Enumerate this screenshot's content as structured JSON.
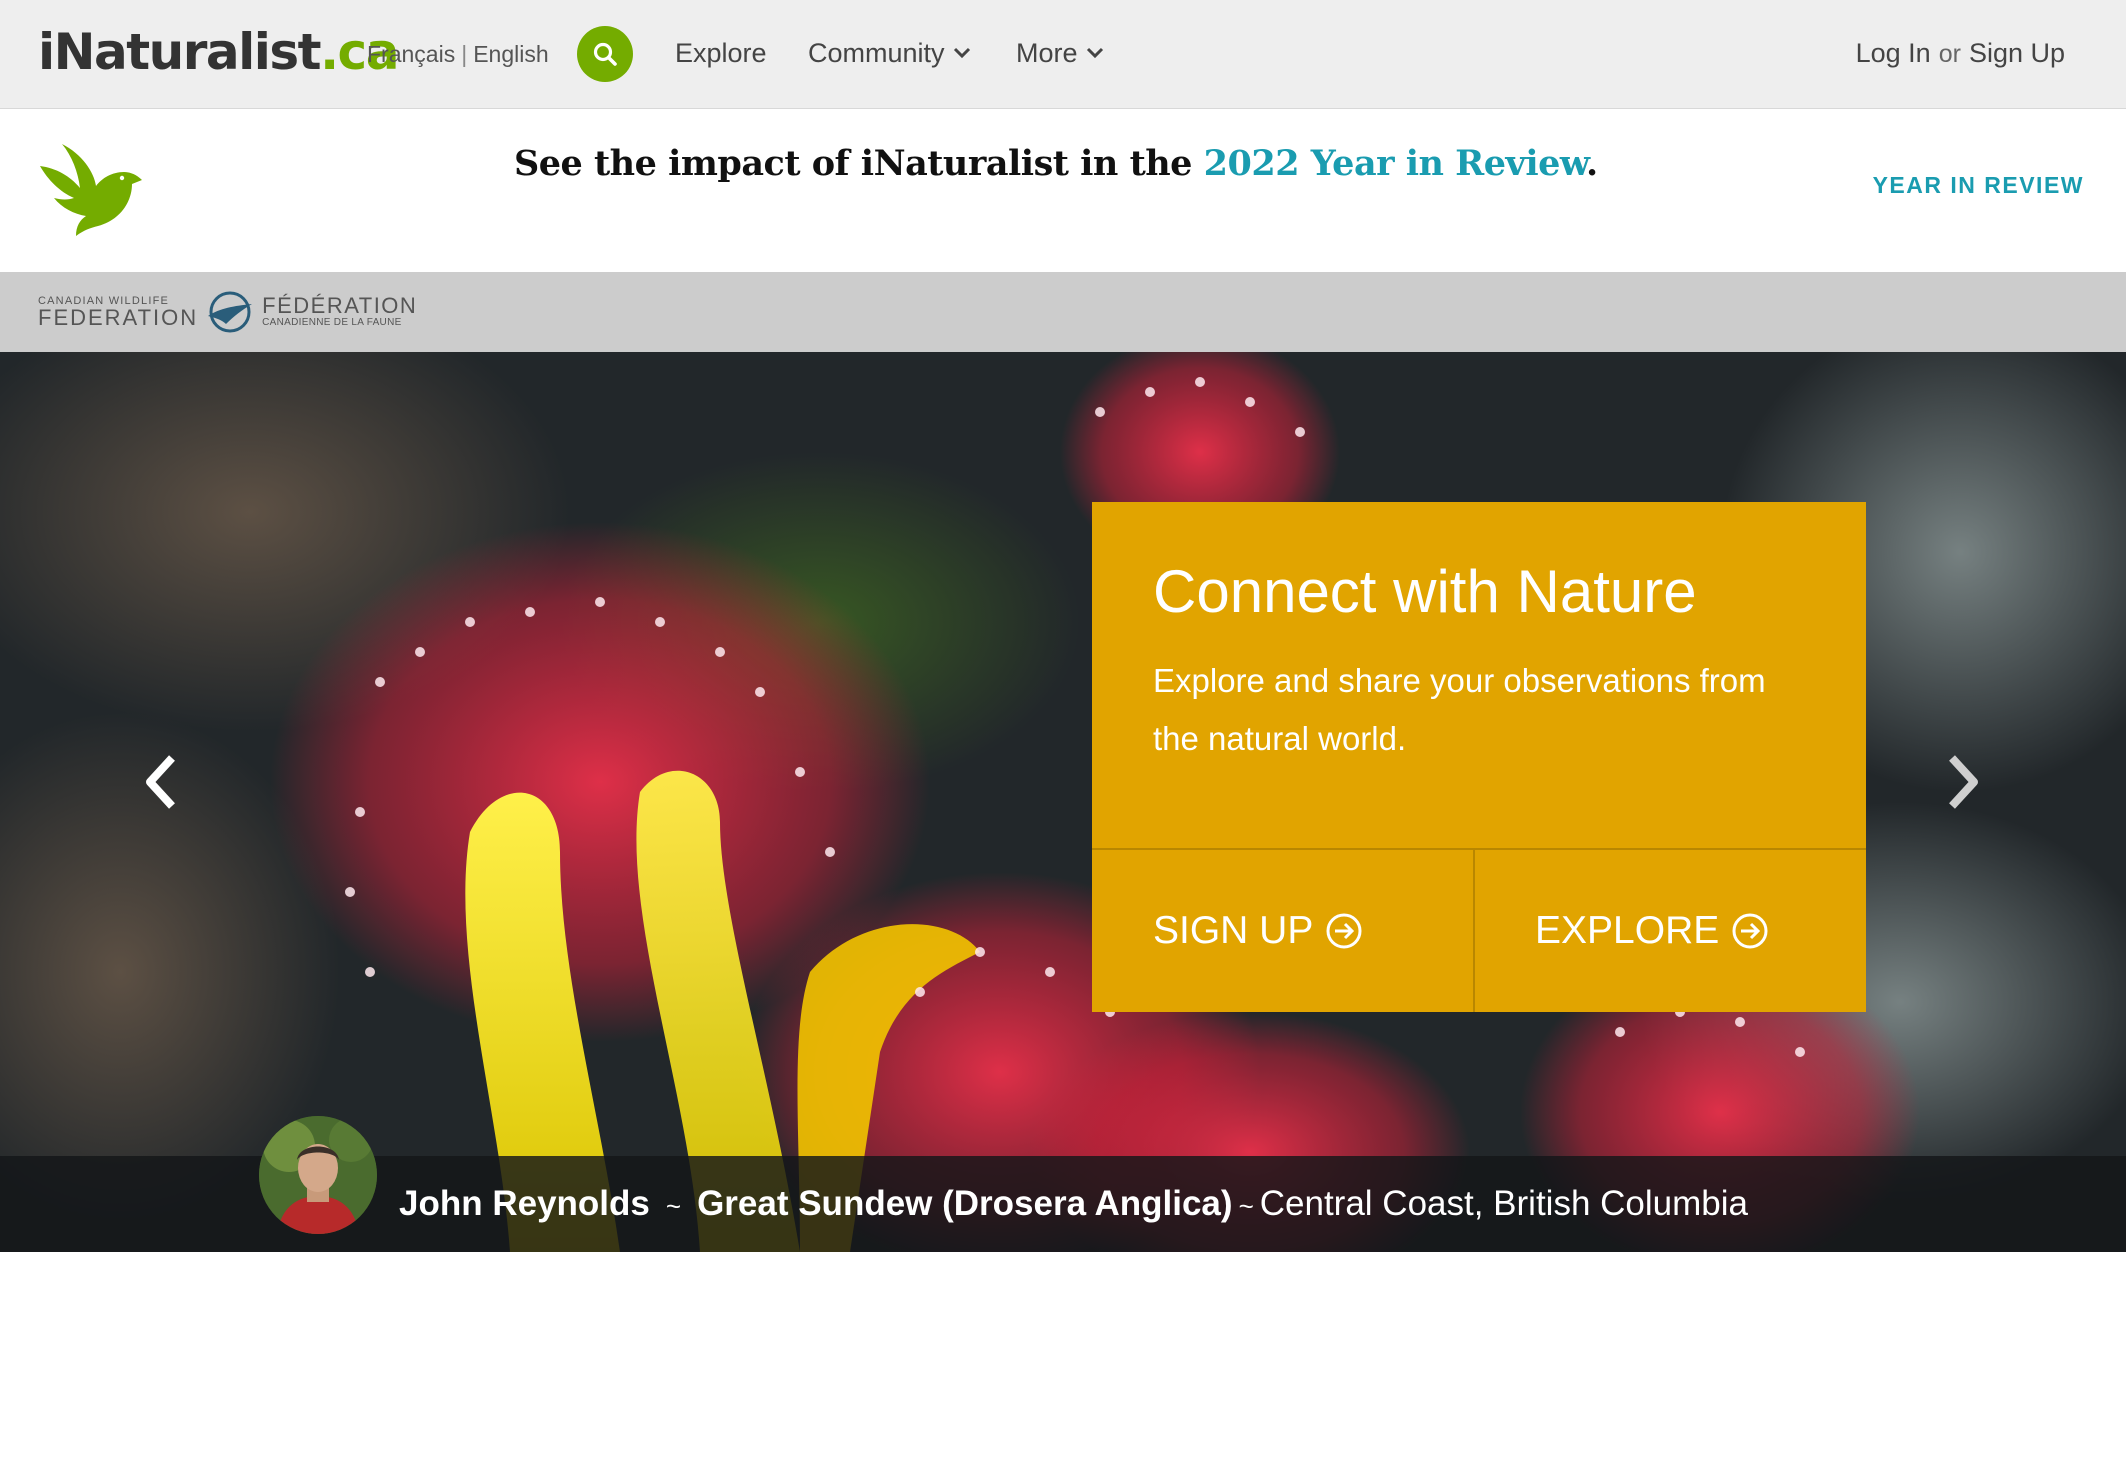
{
  "header": {
    "logo_prefix": "iNaturalist",
    "logo_tld": ".ca",
    "lang_fr": "Français",
    "lang_sep": "|",
    "lang_en": "English",
    "nav": {
      "explore": "Explore",
      "community": "Community",
      "more": "More"
    },
    "login": "Log In",
    "or": "or",
    "signup": "Sign Up"
  },
  "banner": {
    "headline_prefix": "See the impact of iNaturalist in the ",
    "headline_link": "2022 Year in Review",
    "headline_suffix": ".",
    "cta": "YEAR IN REVIEW"
  },
  "partner": {
    "en_small": "CANADIAN WILDLIFE",
    "en_big": "FEDERATION",
    "fr_big": "FÉDÉRATION",
    "fr_small": "CANADIENNE DE LA FAUNE"
  },
  "hero": {
    "title": "Connect with Nature",
    "subtitle": "Explore and share your observations from the natural world.",
    "signup_label": "SIGN UP",
    "explore_label": "EXPLORE",
    "photographer": "John Reynolds",
    "tilde": "~",
    "species": "Great Sundew (Drosera Anglica)",
    "place": "Central Coast, British Columbia"
  },
  "colors": {
    "brand_green": "#74ac00",
    "link_teal": "#1a9cb0",
    "cta_gold": "#e1a400"
  },
  "icons": {
    "search": "search-icon",
    "chevron": "chevron-down-icon",
    "bird": "inat-bird-logo",
    "arrow_left": "chevron-left-icon",
    "arrow_right": "chevron-right-icon",
    "circle_arrow": "arrow-circle-right-icon"
  }
}
